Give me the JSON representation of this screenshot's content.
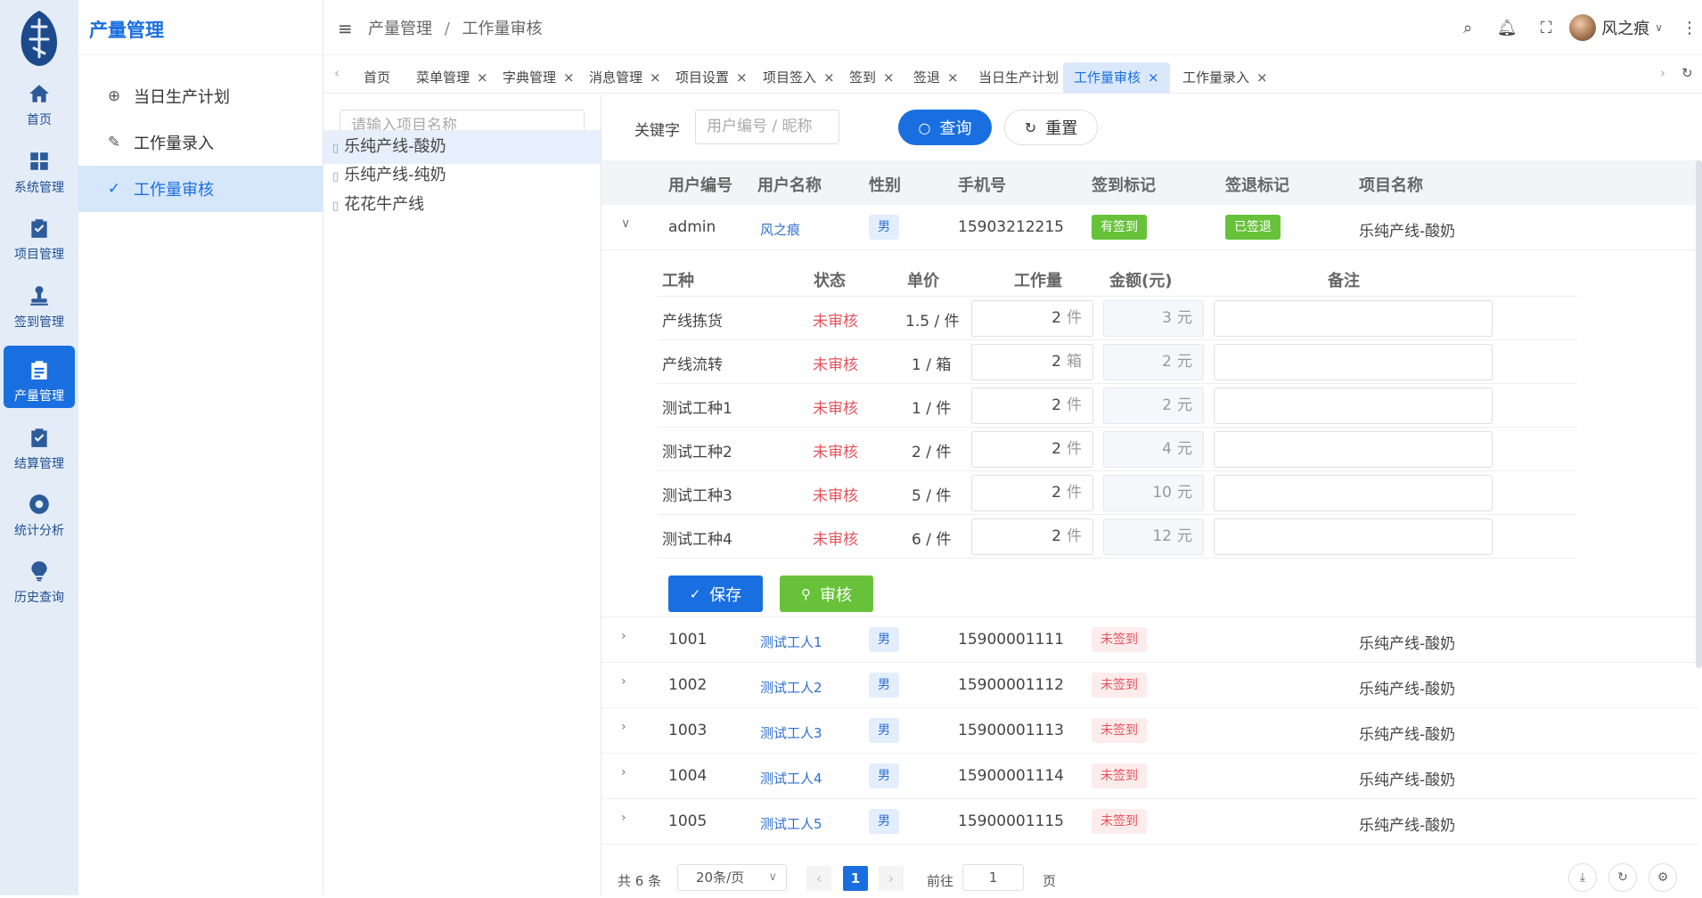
{
  "rail": {
    "items": [
      {
        "label": "首页",
        "icon": "home-icon"
      },
      {
        "label": "系统管理",
        "icon": "grid-icon"
      },
      {
        "label": "项目管理",
        "icon": "clipboard-check-icon"
      },
      {
        "label": "签到管理",
        "icon": "stamp-icon"
      },
      {
        "label": "产量管理",
        "icon": "clipboard-list-icon",
        "active": true
      },
      {
        "label": "结算管理",
        "icon": "clipboard-check-icon"
      },
      {
        "label": "统计分析",
        "icon": "lifebuoy-icon"
      },
      {
        "label": "历史查询",
        "icon": "lightbulb-icon"
      }
    ]
  },
  "menu": {
    "title": "产量管理",
    "items": [
      {
        "label": "当日生产计划",
        "icon": "crosshair-icon"
      },
      {
        "label": "工作量录入",
        "icon": "pencil-icon"
      },
      {
        "label": "工作量审核",
        "icon": "check-icon",
        "active": true
      }
    ]
  },
  "header": {
    "breadcrumb": [
      "产量管理",
      "工作量审核"
    ],
    "separator": "/",
    "user_name": "风之痕"
  },
  "tabs": [
    {
      "label": "首页",
      "closable": false
    },
    {
      "label": "菜单管理",
      "closable": true
    },
    {
      "label": "字典管理",
      "closable": true
    },
    {
      "label": "消息管理",
      "closable": true
    },
    {
      "label": "项目设置",
      "closable": true
    },
    {
      "label": "项目签入",
      "closable": true
    },
    {
      "label": "签到",
      "closable": true
    },
    {
      "label": "签退",
      "closable": true
    },
    {
      "label": "当日生产计划",
      "closable": true
    },
    {
      "label": "工作量审核",
      "closable": true,
      "active": true
    },
    {
      "label": "工作量录入",
      "closable": true
    }
  ],
  "tree": {
    "search_placeholder": "请输入项目名称",
    "items": [
      "乐纯产线-酸奶",
      "乐纯产线-纯奶",
      "花花牛产线"
    ],
    "selected": "乐纯产线-酸奶"
  },
  "search": {
    "label": "关键字",
    "placeholder": "用户编号 / 昵称",
    "query_label": "查询",
    "reset_label": "重置"
  },
  "table": {
    "columns": [
      "用户编号",
      "用户名称",
      "性别",
      "手机号",
      "签到标记",
      "签退标记",
      "项目名称"
    ],
    "rows": [
      {
        "id": "admin",
        "name": "风之痕",
        "gender": "男",
        "phone": "15903212215",
        "signin": "有签到",
        "signout": "已签退",
        "project": "乐纯产线-酸奶",
        "expanded": true
      },
      {
        "id": "1001",
        "name": "测试工人1",
        "gender": "男",
        "phone": "15900001111",
        "signin": "未签到",
        "signout": "",
        "project": "乐纯产线-酸奶"
      },
      {
        "id": "1002",
        "name": "测试工人2",
        "gender": "男",
        "phone": "15900001112",
        "signin": "未签到",
        "signout": "",
        "project": "乐纯产线-酸奶"
      },
      {
        "id": "1003",
        "name": "测试工人3",
        "gender": "男",
        "phone": "15900001113",
        "signin": "未签到",
        "signout": "",
        "project": "乐纯产线-酸奶"
      },
      {
        "id": "1004",
        "name": "测试工人4",
        "gender": "男",
        "phone": "15900001114",
        "signin": "未签到",
        "signout": "",
        "project": "乐纯产线-酸奶"
      },
      {
        "id": "1005",
        "name": "测试工人5",
        "gender": "男",
        "phone": "15900001115",
        "signin": "未签到",
        "signout": "",
        "project": "乐纯产线-酸奶"
      }
    ]
  },
  "detail": {
    "columns": [
      "工种",
      "状态",
      "单价",
      "工作量",
      "金额(元)",
      "备注"
    ],
    "rows": [
      {
        "type": "产线拣货",
        "status": "未审核",
        "price": "1.5 / 件",
        "qty": "2",
        "qty_unit": "件",
        "amount": "3",
        "amount_unit": "元",
        "note": ""
      },
      {
        "type": "产线流转",
        "status": "未审核",
        "price": "1 / 箱",
        "qty": "2",
        "qty_unit": "箱",
        "amount": "2",
        "amount_unit": "元",
        "note": ""
      },
      {
        "type": "测试工种1",
        "status": "未审核",
        "price": "1 / 件",
        "qty": "2",
        "qty_unit": "件",
        "amount": "2",
        "amount_unit": "元",
        "note": ""
      },
      {
        "type": "测试工种2",
        "status": "未审核",
        "price": "2 / 件",
        "qty": "2",
        "qty_unit": "件",
        "amount": "4",
        "amount_unit": "元",
        "note": ""
      },
      {
        "type": "测试工种3",
        "status": "未审核",
        "price": "5 / 件",
        "qty": "2",
        "qty_unit": "件",
        "amount": "10",
        "amount_unit": "元",
        "note": ""
      },
      {
        "type": "测试工种4",
        "status": "未审核",
        "price": "6 / 件",
        "qty": "2",
        "qty_unit": "件",
        "amount": "12",
        "amount_unit": "元",
        "note": ""
      }
    ],
    "save_label": "保存",
    "audit_label": "审核"
  },
  "pager": {
    "total": "共 6 条",
    "page_size": "20条/页",
    "current_page": "1",
    "goto_label": "前往",
    "goto_value": "1",
    "page_suffix": "页"
  },
  "colors": {
    "primary": "#1a6fe0",
    "success": "#67c23a",
    "danger": "#e5525a"
  }
}
